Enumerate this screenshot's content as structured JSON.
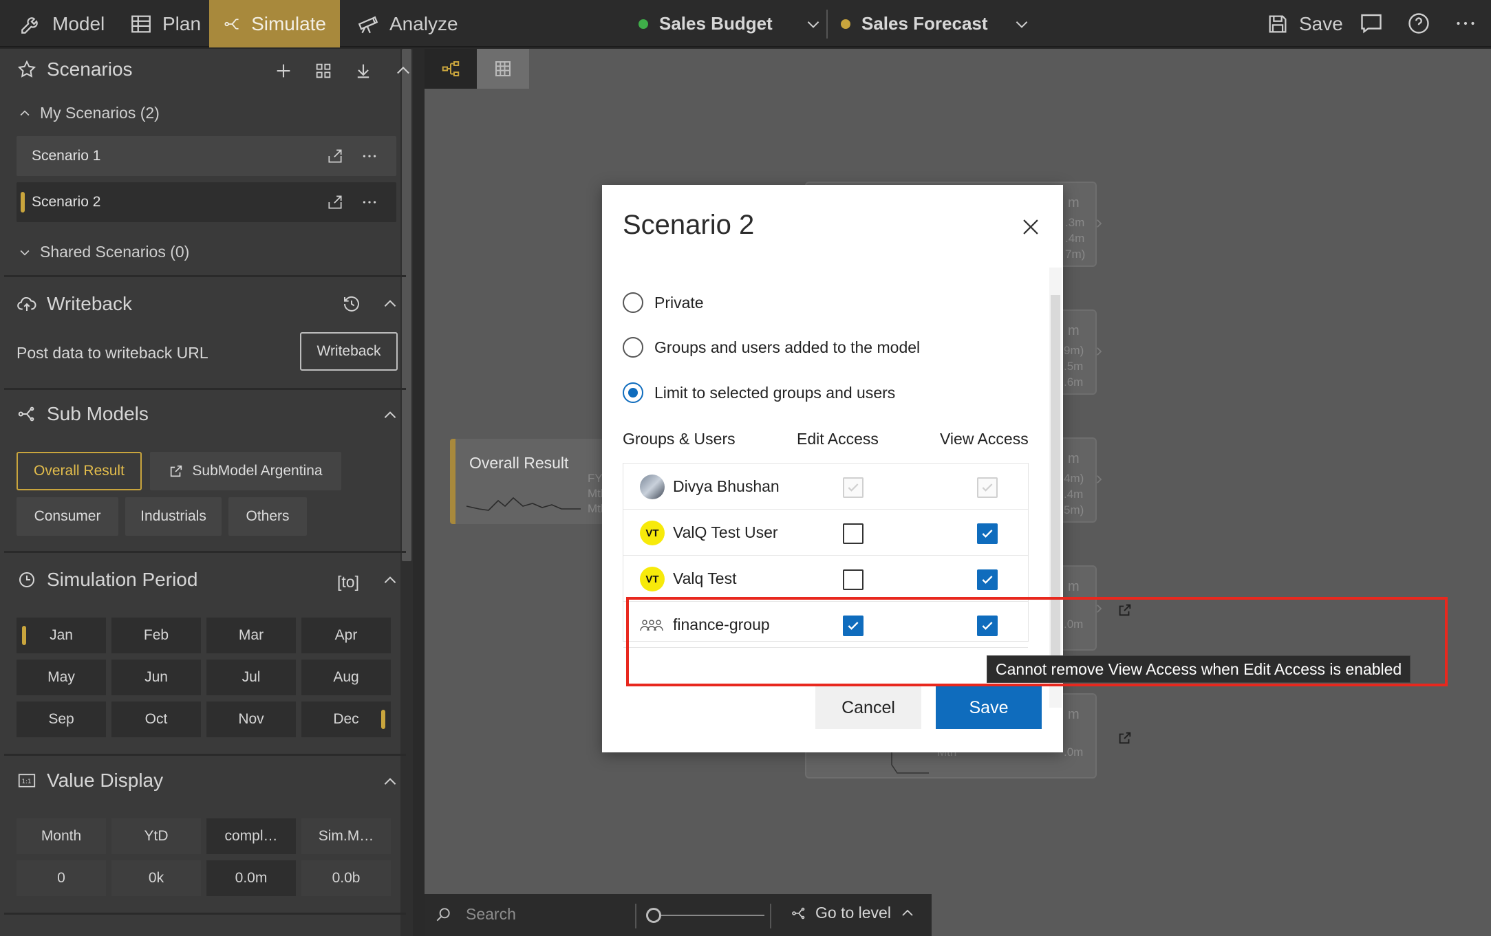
{
  "topbar": {
    "tabs": [
      {
        "label": "Model",
        "icon": "wrench-icon"
      },
      {
        "label": "Plan",
        "icon": "table-icon"
      },
      {
        "label": "Simulate",
        "icon": "branch-icon",
        "active": true
      },
      {
        "label": "Analyze",
        "icon": "telescope-icon"
      }
    ],
    "models": [
      {
        "label": "Sales Budget",
        "color": "#3fae49"
      },
      {
        "label": "Sales Forecast",
        "color": "#c9a53d"
      }
    ],
    "save_label": "Save"
  },
  "sidebar": {
    "scenarios": {
      "title": "Scenarios",
      "my_scenarios_label": "My Scenarios (2)",
      "items": [
        {
          "label": "Scenario 1"
        },
        {
          "label": "Scenario 2",
          "selected": true
        }
      ],
      "shared_label": "Shared Scenarios (0)"
    },
    "writeback": {
      "title": "Writeback",
      "description": "Post data to writeback URL",
      "button_label": "Writeback"
    },
    "submodels": {
      "title": "Sub Models",
      "items": [
        {
          "label": "Overall Result",
          "selected": true
        },
        {
          "label": "SubModel Argentina"
        },
        {
          "label": "Consumer"
        },
        {
          "label": "Industrials"
        },
        {
          "label": "Others"
        }
      ]
    },
    "simulation_period": {
      "title": "Simulation Period",
      "suffix": "[to]",
      "months": [
        "Jan",
        "Feb",
        "Mar",
        "Apr",
        "May",
        "Jun",
        "Jul",
        "Aug",
        "Sep",
        "Oct",
        "Nov",
        "Dec"
      ],
      "range_start": "Jan",
      "range_end": "Dec"
    },
    "value_display": {
      "title": "Value Display",
      "labels": [
        "Month",
        "YtD",
        "compl…",
        "Sim.M…"
      ],
      "values": [
        "0",
        "0k",
        "0.0m",
        "0.0b"
      ]
    }
  },
  "canvas": {
    "overall_node_title": "Overall Result",
    "overall_node_rows": [
      "FY V",
      "Mth",
      "Mth"
    ],
    "node_fragments": [
      {
        "unit": "m",
        "values": [
          ".3m",
          ".4m",
          "7m)"
        ]
      },
      {
        "unit": "m",
        "values": [
          "9m)",
          ".5m",
          ".6m"
        ]
      },
      {
        "unit": "m",
        "values": [
          "4m)",
          ".4m",
          "5m)"
        ]
      },
      {
        "unit": "m",
        "values": [
          ".0m"
        ]
      },
      {
        "unit": "m",
        "values": [
          "Mth",
          ".0m"
        ]
      }
    ]
  },
  "bottombar": {
    "search_placeholder": "Search",
    "goto_label": "Go to level"
  },
  "dialog": {
    "title": "Scenario 2",
    "options": [
      {
        "label": "Private",
        "selected": false
      },
      {
        "label": "Groups and users added to the model",
        "selected": false
      },
      {
        "label": "Limit to selected groups and users",
        "selected": true
      }
    ],
    "columns": [
      "Groups & Users",
      "Edit Access",
      "View Access"
    ],
    "rows": [
      {
        "name": "Divya Bhushan",
        "avatar": "photo",
        "edit": true,
        "view": true,
        "disabled": true
      },
      {
        "name": "ValQ Test User",
        "avatar": "VT",
        "edit": false,
        "view": true,
        "disabled": false
      },
      {
        "name": "Valq Test",
        "avatar": "VT",
        "edit": false,
        "view": true,
        "disabled": false
      },
      {
        "name": "finance-group",
        "avatar": "group-icon",
        "edit": true,
        "view": true,
        "disabled": false
      }
    ],
    "cancel_label": "Cancel",
    "save_label": "Save"
  },
  "tooltip": "Cannot remove View Access when Edit Access is enabled",
  "colors": {
    "accent_gold": "#c9a53d",
    "primary_blue": "#0f6cbd",
    "highlight_red": "#e8281e"
  }
}
